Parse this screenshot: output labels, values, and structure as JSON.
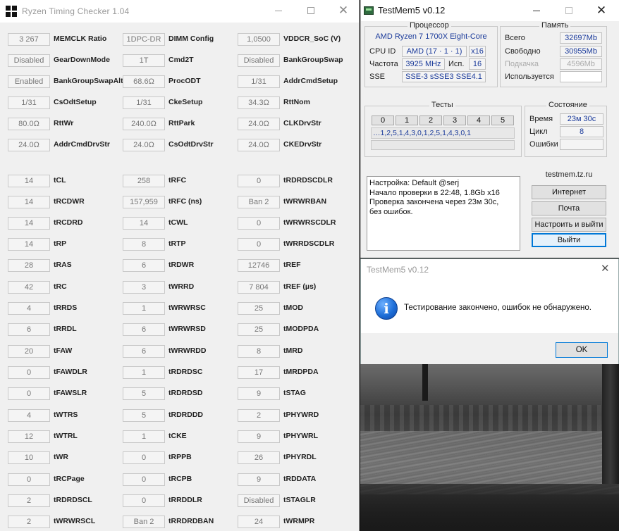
{
  "rtc": {
    "title": "Ryzen Timing Checker 1.04",
    "rows": [
      [
        {
          "v": "3 267",
          "l": "MEMCLK Ratio"
        },
        {
          "v": "1DPC-DR",
          "l": "DIMM Config"
        },
        {
          "v": "1,0500",
          "l": "VDDCR_SoC (V)"
        }
      ],
      [
        {
          "v": "Disabled",
          "l": "GearDownMode"
        },
        {
          "v": "1T",
          "l": "Cmd2T"
        },
        {
          "v": "Disabled",
          "l": "BankGroupSwap"
        }
      ],
      [
        {
          "v": "Enabled",
          "l": "BankGroupSwapAlt"
        },
        {
          "v": "68.6Ω",
          "l": "ProcODT"
        },
        {
          "v": "1/31",
          "l": "AddrCmdSetup"
        }
      ],
      [
        {
          "v": "1/31",
          "l": "CsOdtSetup"
        },
        {
          "v": "1/31",
          "l": "CkeSetup"
        },
        {
          "v": "34.3Ω",
          "l": "RttNom"
        }
      ],
      [
        {
          "v": "80.0Ω",
          "l": "RttWr"
        },
        {
          "v": "240.0Ω",
          "l": "RttPark"
        },
        {
          "v": "24.0Ω",
          "l": "CLKDrvStr"
        }
      ],
      [
        {
          "v": "24.0Ω",
          "l": "AddrCmdDrvStr"
        },
        {
          "v": "24.0Ω",
          "l": "CsOdtDrvStr"
        },
        {
          "v": "24.0Ω",
          "l": "CKEDrvStr"
        }
      ],
      [
        {
          "v": "14",
          "l": "tCL"
        },
        {
          "v": "258",
          "l": "tRFC"
        },
        {
          "v": "0",
          "l": "tRDRDSCDLR"
        }
      ],
      [
        {
          "v": "14",
          "l": "tRCDWR"
        },
        {
          "v": "157,959",
          "l": "tRFC (ns)"
        },
        {
          "v": "Ban 2",
          "l": "tWRWRBAN"
        }
      ],
      [
        {
          "v": "14",
          "l": "tRCDRD"
        },
        {
          "v": "14",
          "l": "tCWL"
        },
        {
          "v": "0",
          "l": "tWRWRSCDLR"
        }
      ],
      [
        {
          "v": "14",
          "l": "tRP"
        },
        {
          "v": "8",
          "l": "tRTP"
        },
        {
          "v": "0",
          "l": "tWRRDSCDLR"
        }
      ],
      [
        {
          "v": "28",
          "l": "tRAS"
        },
        {
          "v": "6",
          "l": "tRDWR"
        },
        {
          "v": "12746",
          "l": "tREF"
        }
      ],
      [
        {
          "v": "42",
          "l": "tRC"
        },
        {
          "v": "3",
          "l": "tWRRD"
        },
        {
          "v": "7 804",
          "l": "tREF (µs)"
        }
      ],
      [
        {
          "v": "4",
          "l": "tRRDS"
        },
        {
          "v": "1",
          "l": "tWRWRSC"
        },
        {
          "v": "25",
          "l": "tMOD"
        }
      ],
      [
        {
          "v": "6",
          "l": "tRRDL"
        },
        {
          "v": "6",
          "l": "tWRWRSD"
        },
        {
          "v": "25",
          "l": "tMODPDA"
        }
      ],
      [
        {
          "v": "20",
          "l": "tFAW"
        },
        {
          "v": "6",
          "l": "tWRWRDD"
        },
        {
          "v": "8",
          "l": "tMRD"
        }
      ],
      [
        {
          "v": "0",
          "l": "tFAWDLR"
        },
        {
          "v": "1",
          "l": "tRDRDSC"
        },
        {
          "v": "17",
          "l": "tMRDPDA"
        }
      ],
      [
        {
          "v": "0",
          "l": "tFAWSLR"
        },
        {
          "v": "5",
          "l": "tRDRDSD"
        },
        {
          "v": "9",
          "l": "tSTAG"
        }
      ],
      [
        {
          "v": "4",
          "l": "tWTRS"
        },
        {
          "v": "5",
          "l": "tRDRDDD"
        },
        {
          "v": "2",
          "l": "tPHYWRD"
        }
      ],
      [
        {
          "v": "12",
          "l": "tWTRL"
        },
        {
          "v": "1",
          "l": "tCKE"
        },
        {
          "v": "9",
          "l": "tPHYWRL"
        }
      ],
      [
        {
          "v": "10",
          "l": "tWR"
        },
        {
          "v": "0",
          "l": "tRPPB"
        },
        {
          "v": "26",
          "l": "tPHYRDL"
        }
      ],
      [
        {
          "v": "0",
          "l": "tRCPage"
        },
        {
          "v": "0",
          "l": "tRCPB"
        },
        {
          "v": "9",
          "l": "tRDDATA"
        }
      ],
      [
        {
          "v": "2",
          "l": "tRDRDSCL"
        },
        {
          "v": "0",
          "l": "tRRDDLR"
        },
        {
          "v": "Disabled",
          "l": "tSTAGLR"
        }
      ],
      [
        {
          "v": "2",
          "l": "tWRWRSCL"
        },
        {
          "v": "Ban 2",
          "l": "tRRDRDBAN"
        },
        {
          "v": "24",
          "l": "tWRMPR"
        }
      ]
    ]
  },
  "tm": {
    "title": "TestMem5 v0.12",
    "cpu": {
      "group_title": "Процессор",
      "name": "AMD Ryzen 7 1700X Eight-Core",
      "cpuid_label": "CPU ID",
      "cpuid_value": "AMD  (17 · 1 · 1)",
      "threads_value": "x16",
      "freq_label": "Частота",
      "freq_value": "3925 MHz",
      "used_label": "Исп.",
      "used_value": "16",
      "sse_label": "SSE",
      "sse_value": "SSE-3 sSSE3 SSE4.1"
    },
    "memory": {
      "group_title": "Память",
      "total_label": "Всего",
      "total_value": "32697Mb",
      "free_label": "Свободно",
      "free_value": "30955Mb",
      "swap_label": "Подкачка",
      "swap_value": "4596Mb",
      "used_label": "Используется",
      "used_value": ""
    },
    "tests": {
      "group_title": "Тесты",
      "headers": [
        "0",
        "1",
        "2",
        "3",
        "4",
        "5"
      ],
      "sequence": "…1,2,5,1,4,3,0,1,2,5,1,4,3,0,1"
    },
    "state": {
      "group_title": "Состояние",
      "time_label": "Время",
      "time_value": "23м 30с",
      "cycle_label": "Цикл",
      "cycle_value": "8",
      "errors_label": "Ошибки",
      "errors_value": ""
    },
    "log": [
      "Настройка: Default @serj",
      "Начало проверки в 22:48, 1.8Gb x16",
      "Проверка закончена через 23м 30с,",
      "без ошибок."
    ],
    "site": "testmem.tz.ru",
    "buttons": {
      "internet": "Интернет",
      "mail": "Почта",
      "configure_exit": "Настроить и выйти",
      "exit": "Выйти"
    }
  },
  "dialog": {
    "title": "TestMem5 v0.12",
    "message": "Тестирование закончено, ошибок не обнаружено.",
    "ok": "OK"
  }
}
